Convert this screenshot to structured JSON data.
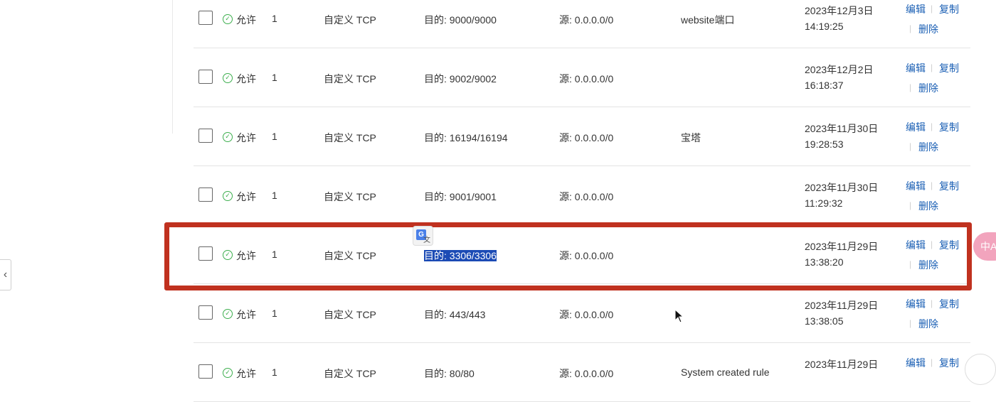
{
  "actions": {
    "edit": "编辑",
    "copy": "复制",
    "delete": "删除"
  },
  "rules": [
    {
      "action": "允许",
      "priority": "1",
      "protocol": "自定义 TCP",
      "dest_prefix": "目的: ",
      "dest_port": "9000/9000",
      "source": "源: 0.0.0.0/0",
      "description": "website端口",
      "time_date": "2023年12月3日",
      "time_clock": "14:19:25"
    },
    {
      "action": "允许",
      "priority": "1",
      "protocol": "自定义 TCP",
      "dest_prefix": "目的: ",
      "dest_port": "9002/9002",
      "source": "源: 0.0.0.0/0",
      "description": "",
      "time_date": "2023年12月2日",
      "time_clock": "16:18:37"
    },
    {
      "action": "允许",
      "priority": "1",
      "protocol": "自定义 TCP",
      "dest_prefix": "目的: ",
      "dest_port": "16194/16194",
      "source": "源: 0.0.0.0/0",
      "description": "宝塔",
      "time_date": "2023年11月30日",
      "time_clock": "19:28:53"
    },
    {
      "action": "允许",
      "priority": "1",
      "protocol": "自定义 TCP",
      "dest_prefix": "目的: ",
      "dest_port": "9001/9001",
      "source": "源: 0.0.0.0/0",
      "description": "",
      "time_date": "2023年11月30日",
      "time_clock": "11:29:32"
    },
    {
      "action": "允许",
      "priority": "1",
      "protocol": "自定义 TCP",
      "dest_prefix": "目的: ",
      "dest_port": "3306/3306",
      "source": "源: 0.0.0.0/0",
      "description": "",
      "time_date": "2023年11月29日",
      "time_clock": "13:38:20"
    },
    {
      "action": "允许",
      "priority": "1",
      "protocol": "自定义 TCP",
      "dest_prefix": "目的: ",
      "dest_port": "443/443",
      "source": "源: 0.0.0.0/0",
      "description": "",
      "time_date": "2023年11月29日",
      "time_clock": "13:38:05"
    },
    {
      "action": "允许",
      "priority": "1",
      "protocol": "自定义 TCP",
      "dest_prefix": "目的: ",
      "dest_port": "80/80",
      "source": "源: 0.0.0.0/0",
      "description": "System created rule",
      "time_date": "2023年11月29日",
      "time_clock": ""
    }
  ],
  "collapse_icon": "chevron-left-icon",
  "lang_float_label": "中A",
  "translate_badge": {
    "g": "G",
    "z": "文"
  },
  "colors": {
    "allow": "#3cae4d",
    "link": "#1a5fb4",
    "highlight": "#c0311f",
    "selection": "#1c4bb5"
  }
}
